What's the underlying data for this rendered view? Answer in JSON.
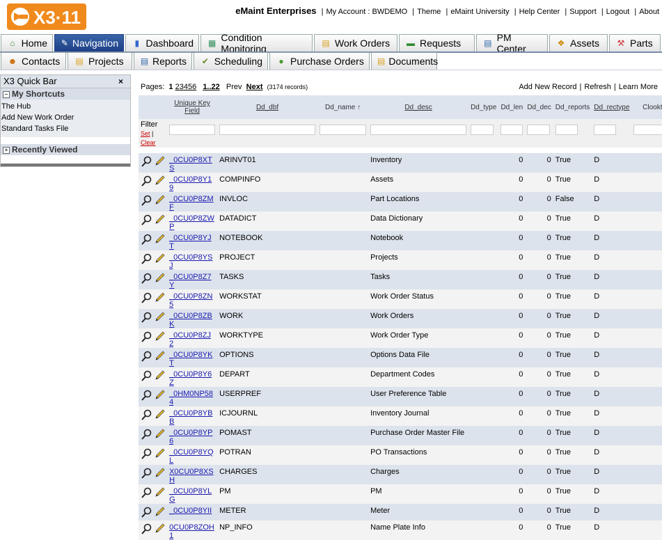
{
  "logo": {
    "text": "X3·11"
  },
  "header": {
    "company": "eMaint Enterprises",
    "links": [
      "My Account : BWDEMO",
      "Theme",
      "eMaint University",
      "Help Center",
      "Support",
      "Logout",
      "About"
    ]
  },
  "tabs_row1": [
    {
      "label": "Home",
      "icon": "home-icon"
    },
    {
      "label": "Navigation",
      "icon": "navigation-icon",
      "active": true
    },
    {
      "label": "Dashboard",
      "icon": "chart-icon"
    },
    {
      "label": "Condition Monitoring",
      "icon": "table-icon"
    },
    {
      "label": "Work Orders",
      "icon": "document-icon"
    },
    {
      "label": "Requests",
      "icon": "speech-icon"
    },
    {
      "label": "PM Center",
      "icon": "pm-icon"
    },
    {
      "label": "Assets",
      "icon": "assets-icon"
    },
    {
      "label": "Parts",
      "icon": "parts-icon"
    }
  ],
  "tabs_row2": [
    {
      "label": "Contacts",
      "icon": "contacts-icon"
    },
    {
      "label": "Projects",
      "icon": "projects-icon"
    },
    {
      "label": "Reports",
      "icon": "reports-icon"
    },
    {
      "label": "Scheduling",
      "icon": "scheduling-icon"
    },
    {
      "label": "Purchase Orders",
      "icon": "purchase-icon"
    },
    {
      "label": "Documents",
      "icon": "documents-icon"
    }
  ],
  "quickbar": {
    "title": "X3 Quick Bar",
    "close": "×",
    "shortcuts_title": "My Shortcuts",
    "shortcuts": [
      "The Hub",
      "Add New Work Order",
      "Standard Tasks File"
    ],
    "recent_title": "Recently Viewed"
  },
  "pager": {
    "label": "Pages:",
    "current": "1",
    "pages": [
      "2",
      "3",
      "4",
      "5",
      "6"
    ],
    "range": "1..22",
    "prev": "Prev",
    "next": "Next",
    "records": "(3174 records)"
  },
  "actions": [
    "Add New Record",
    "Refresh",
    "Learn More"
  ],
  "columns": [
    "Unique Key Field",
    "Dd_dbf",
    "Dd_name ↑",
    "Dd_desc",
    "Dd_type",
    "Dd_len",
    "Dd_dec",
    "Dd_reports",
    "Dd_rectype",
    "Clooktype"
  ],
  "filter": {
    "label": "Filter",
    "set": "Set",
    "clear": "Clear"
  },
  "rows": [
    {
      "key": "_0CU0P8XTS",
      "dbf": "ARINVT01",
      "desc": "Inventory",
      "len": "0",
      "dec": "0",
      "reports": "True",
      "rectype": "D"
    },
    {
      "key": "_0CU0P8Y19",
      "dbf": "COMPINFO",
      "desc": "Assets",
      "len": "0",
      "dec": "0",
      "reports": "True",
      "rectype": "D"
    },
    {
      "key": "_0CU0P8ZMF",
      "dbf": "INVLOC",
      "desc": "Part Locations",
      "len": "0",
      "dec": "0",
      "reports": "False",
      "rectype": "D"
    },
    {
      "key": "_0CU0P8ZWP",
      "dbf": "DATADICT",
      "desc": "Data Dictionary",
      "len": "0",
      "dec": "0",
      "reports": "True",
      "rectype": "D"
    },
    {
      "key": "_0CU0P8YJT",
      "dbf": "NOTEBOOK",
      "desc": "Notebook",
      "len": "0",
      "dec": "0",
      "reports": "True",
      "rectype": "D"
    },
    {
      "key": "_0CU0P8YSJ",
      "dbf": "PROJECT",
      "desc": "Projects",
      "len": "0",
      "dec": "0",
      "reports": "True",
      "rectype": "D"
    },
    {
      "key": "_0CU0P8Z7Y",
      "dbf": "TASKS",
      "desc": "Tasks",
      "len": "0",
      "dec": "0",
      "reports": "True",
      "rectype": "D"
    },
    {
      "key": "_0CU0P8ZN5",
      "dbf": "WORKSTAT",
      "desc": "Work Order Status",
      "len": "0",
      "dec": "0",
      "reports": "True",
      "rectype": "D"
    },
    {
      "key": "_0CU0P8ZBK",
      "dbf": "WORK",
      "desc": "Work Orders",
      "len": "0",
      "dec": "0",
      "reports": "True",
      "rectype": "D"
    },
    {
      "key": "_0CU0P8ZJ2",
      "dbf": "WORKTYPE",
      "desc": "Work Order Type",
      "len": "0",
      "dec": "0",
      "reports": "True",
      "rectype": "D"
    },
    {
      "key": "_0CU0P8YKT",
      "dbf": "OPTIONS",
      "desc": "Options Data File",
      "len": "0",
      "dec": "0",
      "reports": "True",
      "rectype": "D"
    },
    {
      "key": "_0CU0P8Y6Z",
      "dbf": "DEPART",
      "desc": "Department Codes",
      "len": "0",
      "dec": "0",
      "reports": "True",
      "rectype": "D"
    },
    {
      "key": "_0HM0NP584",
      "dbf": "USERPREF",
      "desc": "User Preference Table",
      "len": "0",
      "dec": "0",
      "reports": "True",
      "rectype": "D"
    },
    {
      "key": "_0CU0P8YBB",
      "dbf": "ICJOURNL",
      "desc": "Inventory Journal",
      "len": "0",
      "dec": "0",
      "reports": "True",
      "rectype": "D"
    },
    {
      "key": "_0CU0P8YP6",
      "dbf": "POMAST",
      "desc": "Purchase Order Master File",
      "len": "0",
      "dec": "0",
      "reports": "True",
      "rectype": "D"
    },
    {
      "key": "_0CU0P8YQL",
      "dbf": "POTRAN",
      "desc": "PO Transactions",
      "len": "0",
      "dec": "0",
      "reports": "True",
      "rectype": "D"
    },
    {
      "key": "X0CU0P8XSH",
      "dbf": "CHARGES",
      "desc": "Charges",
      "len": "0",
      "dec": "0",
      "reports": "True",
      "rectype": "D"
    },
    {
      "key": "_0CU0P8YLG",
      "dbf": "PM",
      "desc": "PM",
      "len": "0",
      "dec": "0",
      "reports": "True",
      "rectype": "D"
    },
    {
      "key": "_0CU0P8YII",
      "dbf": "METER",
      "desc": "Meter",
      "len": "0",
      "dec": "0",
      "reports": "True",
      "rectype": "D"
    },
    {
      "key": "0CU0P8ZOH1",
      "dbf": "NP_INFO",
      "desc": "Name Plate Info",
      "len": "0",
      "dec": "0",
      "reports": "True",
      "rectype": "D"
    }
  ]
}
